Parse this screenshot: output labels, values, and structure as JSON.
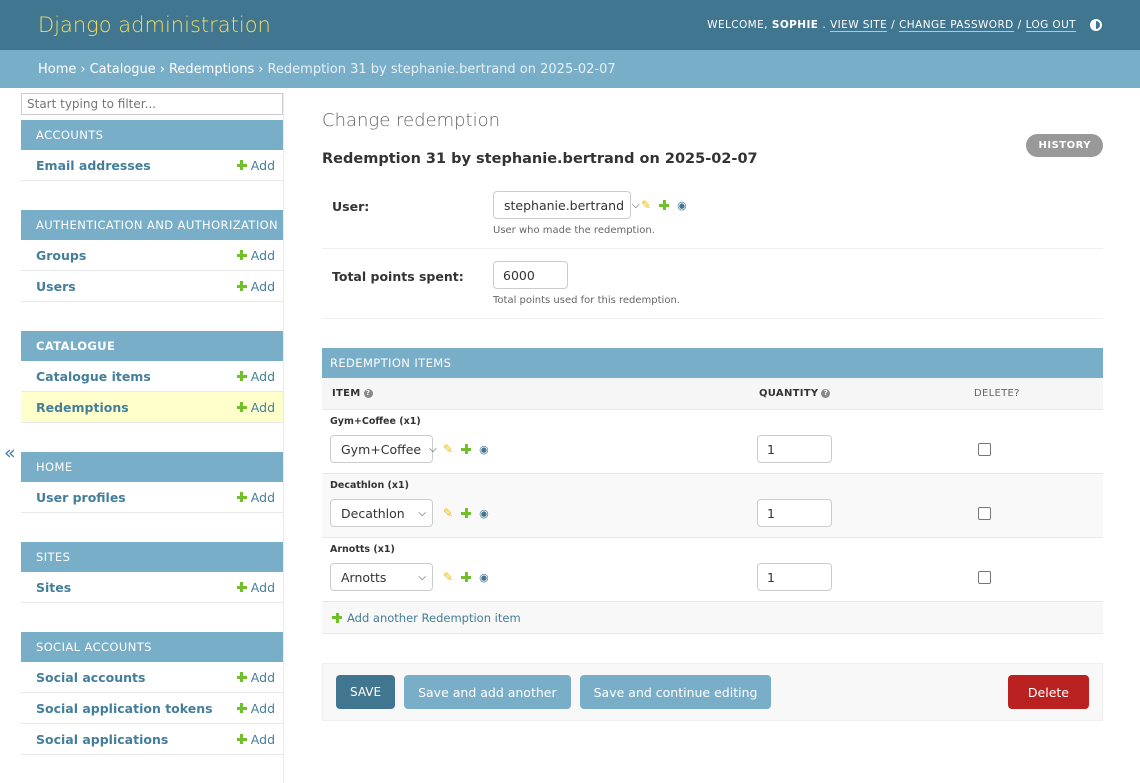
{
  "header": {
    "site_name": "Django administration",
    "welcome": "WELCOME,",
    "username": "SOPHIE",
    "view_site": "VIEW SITE",
    "change_password": "CHANGE PASSWORD",
    "log_out": "LOG OUT",
    "sep": "/"
  },
  "breadcrumbs": {
    "home": "Home",
    "app": "Catalogue",
    "model": "Redemptions",
    "current": "Redemption 31 by stephanie.bertrand on 2025-02-07",
    "sep": "›"
  },
  "sidebar": {
    "filter_placeholder": "Start typing to filter...",
    "add_label": "Add",
    "toggle": "«",
    "modules": [
      {
        "caption": "ACCOUNTS",
        "items": [
          "Email addresses"
        ]
      },
      {
        "caption": "AUTHENTICATION AND AUTHORIZATION",
        "items": [
          "Groups",
          "Users"
        ]
      },
      {
        "caption": "CATALOGUE",
        "items": [
          "Catalogue items",
          "Redemptions"
        ]
      },
      {
        "caption": "HOME",
        "items": [
          "User profiles"
        ]
      },
      {
        "caption": "SITES",
        "items": [
          "Sites"
        ]
      },
      {
        "caption": "SOCIAL ACCOUNTS",
        "items": [
          "Social accounts",
          "Social application tokens",
          "Social applications"
        ]
      }
    ]
  },
  "content": {
    "title": "Change redemption",
    "history": "HISTORY",
    "object_title": "Redemption 31 by stephanie.bertrand on 2025-02-07",
    "fields": {
      "user_label": "User:",
      "user_value": "stephanie.bertrand",
      "user_help": "User who made the redemption.",
      "points_label": "Total points spent:",
      "points_value": "6000",
      "points_help": "Total points used  for this redemption."
    },
    "inline": {
      "caption": "REDEMPTION ITEMS",
      "col_item": "ITEM",
      "col_quantity": "QUANTITY",
      "col_delete": "DELETE?",
      "rows": [
        {
          "original": "Gym+Coffee (x1)",
          "item": "Gym+Coffee",
          "quantity": "1"
        },
        {
          "original": "Decathlon (x1)",
          "item": "Decathlon",
          "quantity": "1"
        },
        {
          "original": "Arnotts (x1)",
          "item": "Arnotts",
          "quantity": "1"
        }
      ],
      "add_another": "Add another Redemption item"
    },
    "submit": {
      "save": "SAVE",
      "save_add": "Save and add another",
      "save_continue": "Save and continue editing",
      "delete": "Delete"
    }
  },
  "colors": {
    "header": "#417690",
    "breadcrumb": "#79aec8",
    "site_name": "#f5dd5d",
    "link": "#447e9b",
    "add_green": "#70bf2b",
    "delete_red": "#ba2121",
    "current_row": "#ffffcc"
  }
}
